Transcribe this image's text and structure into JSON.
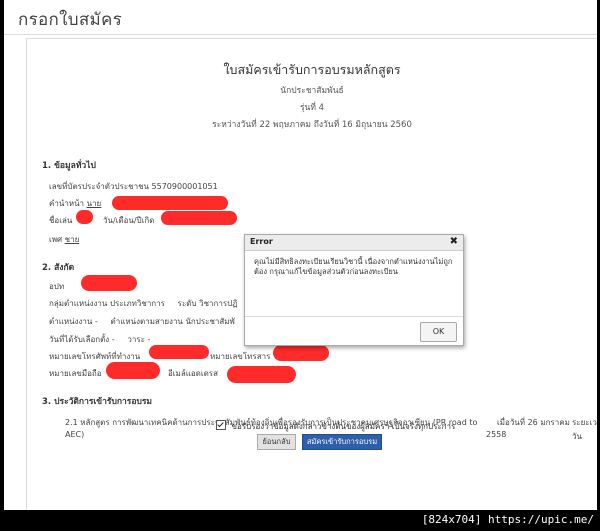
{
  "page": {
    "header_title": "กรอกใบสมัคร"
  },
  "form": {
    "title": "ใบสมัครเข้ารับการอบรมหลักสูตร",
    "program": "นักประชาสัมพันธ์",
    "batch": "รุ่นที่ 4",
    "period": "ระหว่างวันที่ 22 พฤษภาคม ถึงวันที่ 16 มิถุนายน 2560"
  },
  "section1": {
    "heading": "1. ข้อมูลทั่วไป",
    "id_label": "เลขที่บัตรประจำตัวประชาชน",
    "id_value": "5570900001051",
    "prefix_label": "คำนำหน้า",
    "prefix_value": "นาย",
    "nickname_label": "ชื่อเล่น",
    "birth_label": "วัน/เดือน/ปีเกิด",
    "gender_label": "เพศ",
    "gender_value": "ชาย"
  },
  "section2": {
    "heading": "2. สังกัด",
    "org_label": "อปท",
    "group_label": "กลุ่มตำแหน่งงาน",
    "group_value": "ประเภทวิชาการ",
    "level_label": "ระดับ",
    "level_value": "วิชาการปฏิ",
    "position_label": "ตำแหน่งงาน",
    "position_value": "-",
    "line_position_label": "ตำแหน่งตามสายงาน",
    "line_position_value": "นักประชาสัมพั",
    "elected_date_label": "วันที่ได้รับเลือกตั้ง",
    "elected_date_value": "-",
    "term_label": "วาระ",
    "term_value": "-",
    "work_phone_label": "หมายเลขโทรศัพท์ที่ทำงาน",
    "fax_label": "หมายเลขโทรสาร",
    "mobile_label": "หมายเลขมือถือ",
    "email_label": "อีเมล์แอดเดรส"
  },
  "section3": {
    "heading": "3. ประวัติการเข้ารับการอบรม",
    "course_text": "2.1 หลักสูตร การพัฒนาเทคนิคด้านการประชาสัมพันธ์ท้องถิ่นเพื่อรองรับการเป็นประชาคมเศรษฐกิจอาเซียน (PR road to",
    "course_text2": "AEC)",
    "course_date": "เมื่อวันที่ 26 มกราคม",
    "course_year": "2558",
    "course_duration": "ระยะเว",
    "course_duration2": "วัน"
  },
  "consent": {
    "label": "ขอรับรองว่าข้อมูลดังกล่าวข้างต้นของผู้สมัครฯ เป็นจริงทุกประการ",
    "checked": true
  },
  "buttons": {
    "back": "ย้อนกลับ",
    "submit": "สมัครเข้ารับการอบรม"
  },
  "modal": {
    "title": "Error",
    "message": "คุณไม่มีสิทธิลงทะเบียนเรียนวิชานี้ เนื่องจากตำแหน่งงานไม่ถูกต้อง กรุณาแก้ไขข้อมูลส่วนตัวก่อนลงทะเบียน",
    "ok_label": "OK"
  },
  "watermark": {
    "text": "[824x704] https://upic.me/"
  },
  "colors": {
    "redaction": "#ff2a2a",
    "submit_button": "#2f5fa8",
    "modal_header": "#ececec"
  }
}
